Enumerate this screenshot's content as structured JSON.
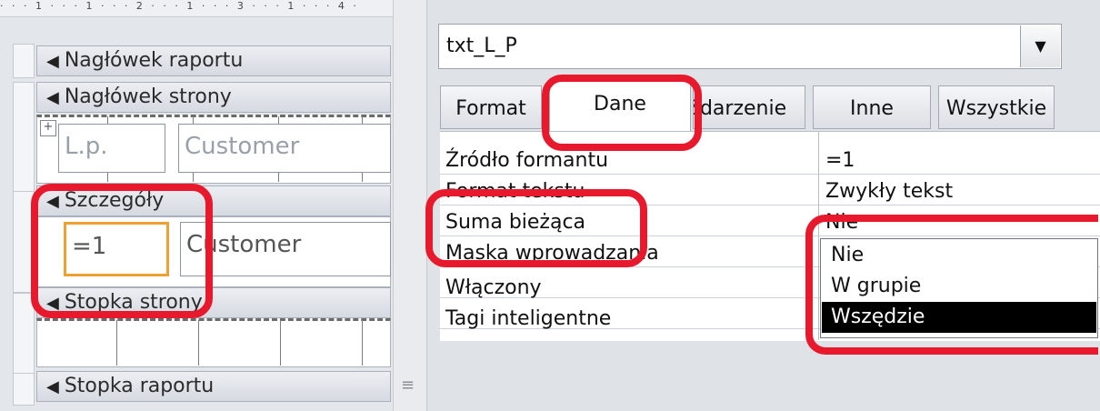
{
  "left_pane": {
    "ruler_text": "· · · 1 · · · 1 · · · 2 · · · 1 · · · 3 · · · 1 · · · 4 ·",
    "sections": {
      "report_header": "Nagłówek raportu",
      "page_header": "Nagłówek strony",
      "details": "Szczegóły",
      "page_footer": "Stopka strony",
      "report_footer": "Stopka raportu"
    },
    "page_header_fields": {
      "lp": "L.p.",
      "customer": "Customer"
    },
    "details_fields": {
      "value": "=1",
      "customer": "Customer"
    },
    "splitter_grip": "≡"
  },
  "property_sheet": {
    "selected_control": "txt_L_P",
    "tabs": [
      "Format",
      "Dane",
      "Zdarzenie",
      "Inne",
      "Wszystkie"
    ],
    "active_tab": "Dane",
    "properties": [
      {
        "name": "Źródło formantu",
        "value": "=1"
      },
      {
        "name": "Format tekstu",
        "value": "Zwykły tekst"
      },
      {
        "name": "Suma bieżąca",
        "value": "Nie"
      },
      {
        "name": "Maska wprowadzania",
        "value": ""
      },
      {
        "name": "Włączony",
        "value": ""
      },
      {
        "name": "Tagi inteligentne",
        "value": ""
      }
    ],
    "dropdown_options": [
      "Nie",
      "W grupie",
      "Wszędzie"
    ],
    "dropdown_selected": "Wszędzie"
  },
  "colors": {
    "highlight": "#e8192c",
    "selection_border": "#f0a030",
    "option_selected_bg": "#000000"
  },
  "icons": {
    "section_arrow": "section-expand-icon",
    "combo_arrow": "dropdown-arrow-icon",
    "move_handle": "move-handle-icon"
  }
}
